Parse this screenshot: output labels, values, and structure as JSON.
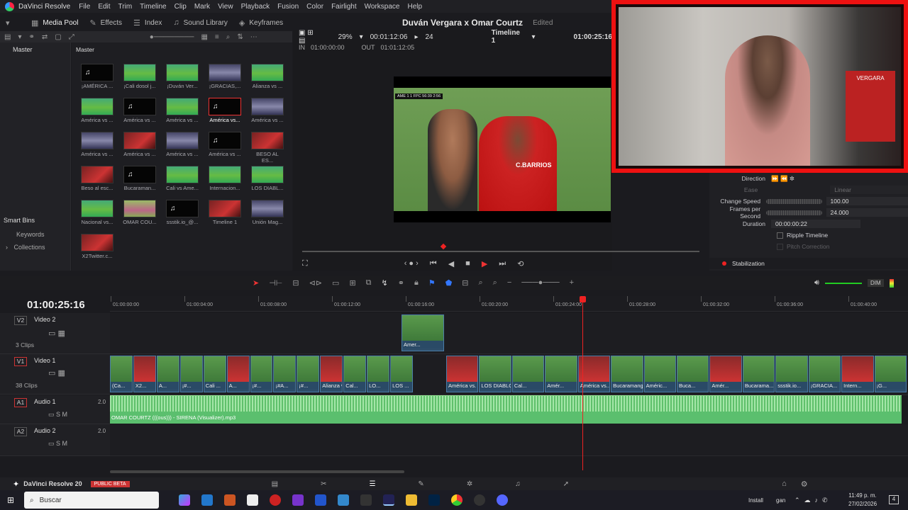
{
  "app": {
    "name": "DaVinci Resolve",
    "menus": [
      "File",
      "Edit",
      "Trim",
      "Timeline",
      "Clip",
      "Mark",
      "View",
      "Playback",
      "Fusion",
      "Color",
      "Fairlight",
      "Workspace",
      "Help"
    ]
  },
  "toolbar": {
    "media_pool": "Media Pool",
    "effects": "Effects",
    "index": "Index",
    "sound_library": "Sound Library",
    "keyframes": "Keyframes"
  },
  "project": {
    "title": "Duván Vergara x Omar Courtz",
    "status": "Edited"
  },
  "viewer": {
    "zoom": "29%",
    "duration": "00:01:12:06",
    "fps": "24",
    "timeline_name": "Timeline 1",
    "timecode": "01:00:25:16",
    "in_label": "IN",
    "in_tc": "01:00:00:00",
    "out_label": "OUT",
    "out_tc": "01:01:12:05",
    "scoreboard": "AME 1 1 FPC 56:39 2:56",
    "player_name": "C.BARRIOS"
  },
  "left_panel": {
    "master": "Master",
    "smart_bins": "Smart Bins",
    "keywords": "Keywords",
    "collections": "Collections"
  },
  "media_pool": {
    "header": "Master",
    "clips": [
      {
        "label": "¡AMÉRICA ...",
        "kind": "black",
        "audio": true
      },
      {
        "label": "¡Cali dosol j...",
        "kind": "grass"
      },
      {
        "label": "¡Duván Ver...",
        "kind": "grass"
      },
      {
        "label": "¡GRACIAS,...",
        "kind": "blue"
      },
      {
        "label": "Alianza vs ...",
        "kind": "grass"
      },
      {
        "label": "América vs ...",
        "kind": "grass"
      },
      {
        "label": "América vs ...",
        "kind": "black",
        "audio": true
      },
      {
        "label": "América vs ...",
        "kind": "grass"
      },
      {
        "label": "América vs...",
        "kind": "black",
        "audio": true,
        "selected": true
      },
      {
        "label": "América vs ...",
        "kind": "blue"
      },
      {
        "label": "América vs ...",
        "kind": "blue"
      },
      {
        "label": "América vs ...",
        "kind": "red"
      },
      {
        "label": "América vs ...",
        "kind": "blue"
      },
      {
        "label": "América vs ...",
        "kind": "black",
        "audio": true
      },
      {
        "label": "BESO AL ES...",
        "kind": "red"
      },
      {
        "label": "Beso al esc...",
        "kind": "red"
      },
      {
        "label": "Bucaraman...",
        "kind": "black",
        "audio": true
      },
      {
        "label": "Cali vs Ame...",
        "kind": "grass"
      },
      {
        "label": "Internacion...",
        "kind": "grass"
      },
      {
        "label": "LOS DIABL...",
        "kind": "grass"
      },
      {
        "label": "Nacional vs...",
        "kind": "grass"
      },
      {
        "label": "OMAR COU...",
        "kind": "pink"
      },
      {
        "label": "ssstik.io_@...",
        "kind": "black",
        "audio": true
      },
      {
        "label": "Timeline 1",
        "kind": "red"
      },
      {
        "label": "Unión Mag...",
        "kind": "blue"
      },
      {
        "label": "X2Twitter.c...",
        "kind": "red"
      }
    ]
  },
  "inspector": {
    "direction": "Direction",
    "ease": "Ease",
    "ease_value": "Linear",
    "change_speed": "Change Speed",
    "speed_value": "100.00",
    "fps_label": "Frames per Second",
    "fps_value": "24.000",
    "duration_label": "Duration",
    "duration_value": "00:00:00:22",
    "ripple": "Ripple Timeline",
    "pitch": "Pitch Correction",
    "stabilization": "Stabilization"
  },
  "timeline": {
    "timecode": "01:00:25:16",
    "dim": "DIM",
    "ruler": [
      "01:00:00:00",
      "01:00:04:00",
      "01:00:08:00",
      "01:00:12:00",
      "01:00:16:00",
      "01:00:20:00",
      "01:00:24:00",
      "01:00:28:00",
      "01:00:32:00",
      "01:00:36:00",
      "01:00:40:00"
    ],
    "tracks": [
      {
        "id": "V2",
        "name": "Video 2",
        "count": "3 Clips"
      },
      {
        "id": "V1",
        "name": "Video 1",
        "count": "38 Clips"
      },
      {
        "id": "A1",
        "name": "Audio 1",
        "level": "2.0"
      },
      {
        "id": "A2",
        "name": "Audio 2",
        "level": "2.0"
      }
    ],
    "v2_clip": "Amer...",
    "v1_clips": [
      "(Ca...",
      "X2...",
      "A...",
      "¡#...",
      "Cali ...",
      "A...",
      "¡#...",
      "¡#A...",
      "¡#...",
      "Alianza v...",
      "Cal...",
      "LO...",
      "LOS ...",
      "América vs. F...",
      "LOS DIABLOS ROJ...",
      "Cal...",
      "Amér...",
      "América vs...",
      "Bucaramanga ...",
      "Améric...",
      "Buca...",
      "Amér...",
      "Bucarama...",
      "ssstik.io...",
      "¡GRACIA...",
      "Intern...",
      "¡G..."
    ],
    "audio_clip": "OMAR COURTZ (((ous))) - SIRENA (Visualizer).mp3"
  },
  "pages_bar": {
    "version": "DaVinci Resolve 20",
    "badge": "PUBLIC BETA"
  },
  "taskbar": {
    "search": "Buscar",
    "install": "Install",
    "time": "11:49 p. m.",
    "date": "27/02/2026",
    "lang": "gan",
    "notifications": "4"
  }
}
